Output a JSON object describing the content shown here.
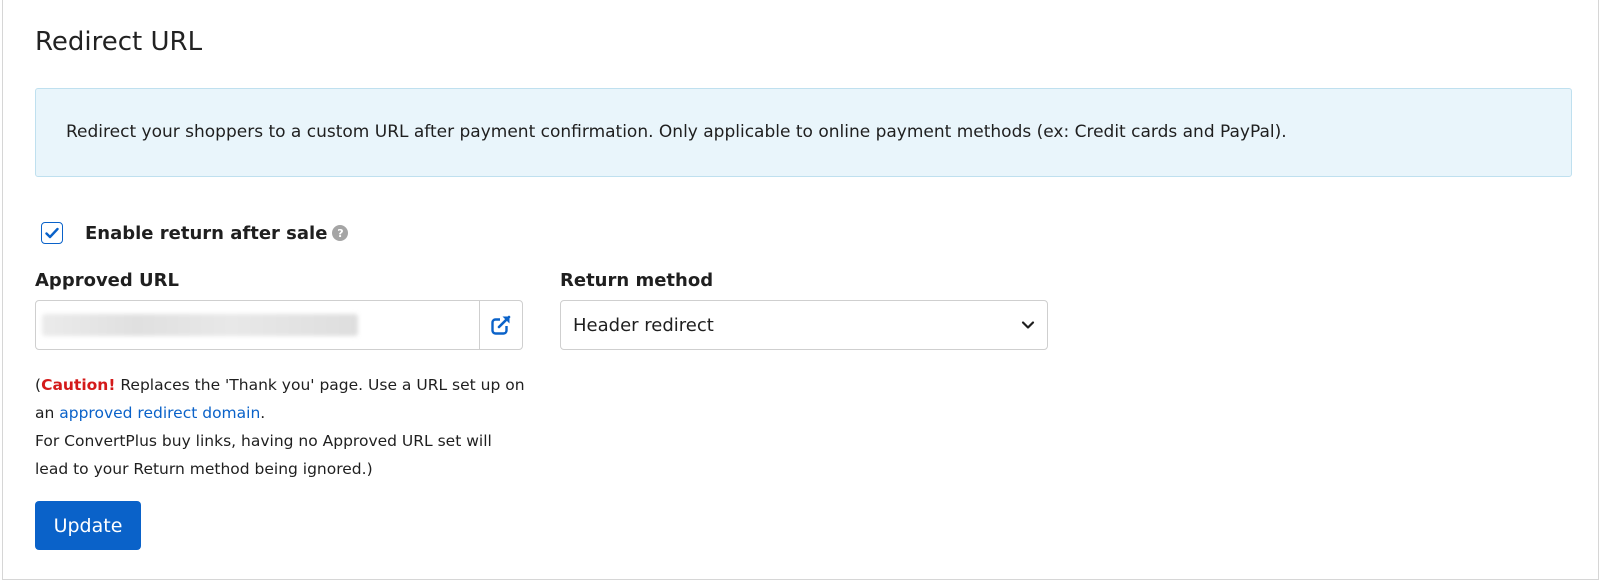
{
  "page": {
    "title": "Redirect URL"
  },
  "info": {
    "text": "Redirect your shoppers to a custom URL after payment confirmation. Only applicable to online payment methods (ex: Credit cards and PayPal)."
  },
  "enable_return": {
    "label": "Enable return after sale",
    "checked": true,
    "help_icon": "question-circle-icon"
  },
  "approved_url": {
    "label": "Approved URL",
    "value": "",
    "open_icon": "external-link-icon"
  },
  "return_method": {
    "label": "Return method",
    "selected": "Header redirect",
    "chevron_icon": "chevron-down-icon"
  },
  "caution": {
    "open_paren": "(",
    "warn": "Caution!",
    "text1": " Replaces the 'Thank you' page. Use a URL set up on an ",
    "link": "approved redirect domain",
    "text2": ".",
    "text3": "For ConvertPlus buy links, having no Approved URL set will lead to your Return method being ignored.)"
  },
  "actions": {
    "update_label": "Update"
  },
  "colors": {
    "primary": "#0a62c9",
    "caution": "#d41a1a",
    "info_bg": "#e9f5fb"
  }
}
